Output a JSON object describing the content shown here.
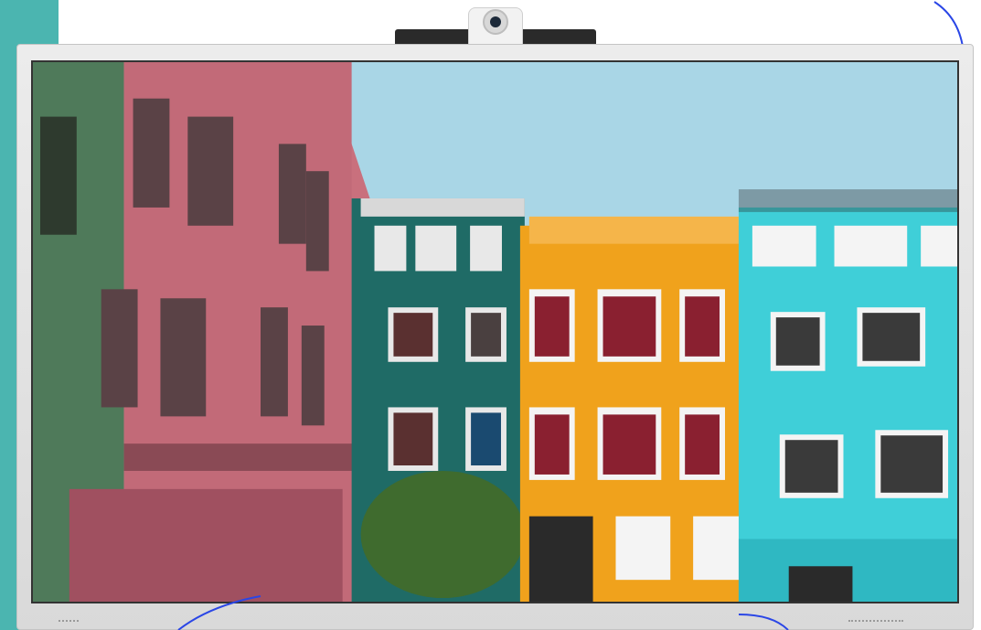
{
  "display": {
    "device": "interactive-flat-panel",
    "accent_color": "#4bb5b0",
    "arc_color": "#2a46e6",
    "screen_image": "colorful-row-houses-photo",
    "building_colors": {
      "pink": "#c9707d",
      "green": "#1f6b66",
      "orange": "#f0a21c",
      "turquoise": "#3fcfd8",
      "sky": "#a9d6e6"
    }
  }
}
